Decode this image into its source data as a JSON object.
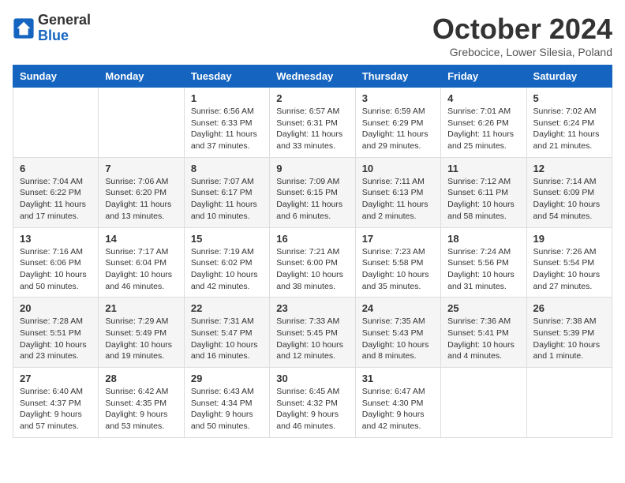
{
  "logo": {
    "text_general": "General",
    "text_blue": "Blue"
  },
  "title": "October 2024",
  "subtitle": "Grebocice, Lower Silesia, Poland",
  "days_of_week": [
    "Sunday",
    "Monday",
    "Tuesday",
    "Wednesday",
    "Thursday",
    "Friday",
    "Saturday"
  ],
  "weeks": [
    [
      {
        "day": "",
        "info": ""
      },
      {
        "day": "",
        "info": ""
      },
      {
        "day": "1",
        "info": "Sunrise: 6:56 AM\nSunset: 6:33 PM\nDaylight: 11 hours and 37 minutes."
      },
      {
        "day": "2",
        "info": "Sunrise: 6:57 AM\nSunset: 6:31 PM\nDaylight: 11 hours and 33 minutes."
      },
      {
        "day": "3",
        "info": "Sunrise: 6:59 AM\nSunset: 6:29 PM\nDaylight: 11 hours and 29 minutes."
      },
      {
        "day": "4",
        "info": "Sunrise: 7:01 AM\nSunset: 6:26 PM\nDaylight: 11 hours and 25 minutes."
      },
      {
        "day": "5",
        "info": "Sunrise: 7:02 AM\nSunset: 6:24 PM\nDaylight: 11 hours and 21 minutes."
      }
    ],
    [
      {
        "day": "6",
        "info": "Sunrise: 7:04 AM\nSunset: 6:22 PM\nDaylight: 11 hours and 17 minutes."
      },
      {
        "day": "7",
        "info": "Sunrise: 7:06 AM\nSunset: 6:20 PM\nDaylight: 11 hours and 13 minutes."
      },
      {
        "day": "8",
        "info": "Sunrise: 7:07 AM\nSunset: 6:17 PM\nDaylight: 11 hours and 10 minutes."
      },
      {
        "day": "9",
        "info": "Sunrise: 7:09 AM\nSunset: 6:15 PM\nDaylight: 11 hours and 6 minutes."
      },
      {
        "day": "10",
        "info": "Sunrise: 7:11 AM\nSunset: 6:13 PM\nDaylight: 11 hours and 2 minutes."
      },
      {
        "day": "11",
        "info": "Sunrise: 7:12 AM\nSunset: 6:11 PM\nDaylight: 10 hours and 58 minutes."
      },
      {
        "day": "12",
        "info": "Sunrise: 7:14 AM\nSunset: 6:09 PM\nDaylight: 10 hours and 54 minutes."
      }
    ],
    [
      {
        "day": "13",
        "info": "Sunrise: 7:16 AM\nSunset: 6:06 PM\nDaylight: 10 hours and 50 minutes."
      },
      {
        "day": "14",
        "info": "Sunrise: 7:17 AM\nSunset: 6:04 PM\nDaylight: 10 hours and 46 minutes."
      },
      {
        "day": "15",
        "info": "Sunrise: 7:19 AM\nSunset: 6:02 PM\nDaylight: 10 hours and 42 minutes."
      },
      {
        "day": "16",
        "info": "Sunrise: 7:21 AM\nSunset: 6:00 PM\nDaylight: 10 hours and 38 minutes."
      },
      {
        "day": "17",
        "info": "Sunrise: 7:23 AM\nSunset: 5:58 PM\nDaylight: 10 hours and 35 minutes."
      },
      {
        "day": "18",
        "info": "Sunrise: 7:24 AM\nSunset: 5:56 PM\nDaylight: 10 hours and 31 minutes."
      },
      {
        "day": "19",
        "info": "Sunrise: 7:26 AM\nSunset: 5:54 PM\nDaylight: 10 hours and 27 minutes."
      }
    ],
    [
      {
        "day": "20",
        "info": "Sunrise: 7:28 AM\nSunset: 5:51 PM\nDaylight: 10 hours and 23 minutes."
      },
      {
        "day": "21",
        "info": "Sunrise: 7:29 AM\nSunset: 5:49 PM\nDaylight: 10 hours and 19 minutes."
      },
      {
        "day": "22",
        "info": "Sunrise: 7:31 AM\nSunset: 5:47 PM\nDaylight: 10 hours and 16 minutes."
      },
      {
        "day": "23",
        "info": "Sunrise: 7:33 AM\nSunset: 5:45 PM\nDaylight: 10 hours and 12 minutes."
      },
      {
        "day": "24",
        "info": "Sunrise: 7:35 AM\nSunset: 5:43 PM\nDaylight: 10 hours and 8 minutes."
      },
      {
        "day": "25",
        "info": "Sunrise: 7:36 AM\nSunset: 5:41 PM\nDaylight: 10 hours and 4 minutes."
      },
      {
        "day": "26",
        "info": "Sunrise: 7:38 AM\nSunset: 5:39 PM\nDaylight: 10 hours and 1 minute."
      }
    ],
    [
      {
        "day": "27",
        "info": "Sunrise: 6:40 AM\nSunset: 4:37 PM\nDaylight: 9 hours and 57 minutes."
      },
      {
        "day": "28",
        "info": "Sunrise: 6:42 AM\nSunset: 4:35 PM\nDaylight: 9 hours and 53 minutes."
      },
      {
        "day": "29",
        "info": "Sunrise: 6:43 AM\nSunset: 4:34 PM\nDaylight: 9 hours and 50 minutes."
      },
      {
        "day": "30",
        "info": "Sunrise: 6:45 AM\nSunset: 4:32 PM\nDaylight: 9 hours and 46 minutes."
      },
      {
        "day": "31",
        "info": "Sunrise: 6:47 AM\nSunset: 4:30 PM\nDaylight: 9 hours and 42 minutes."
      },
      {
        "day": "",
        "info": ""
      },
      {
        "day": "",
        "info": ""
      }
    ]
  ]
}
